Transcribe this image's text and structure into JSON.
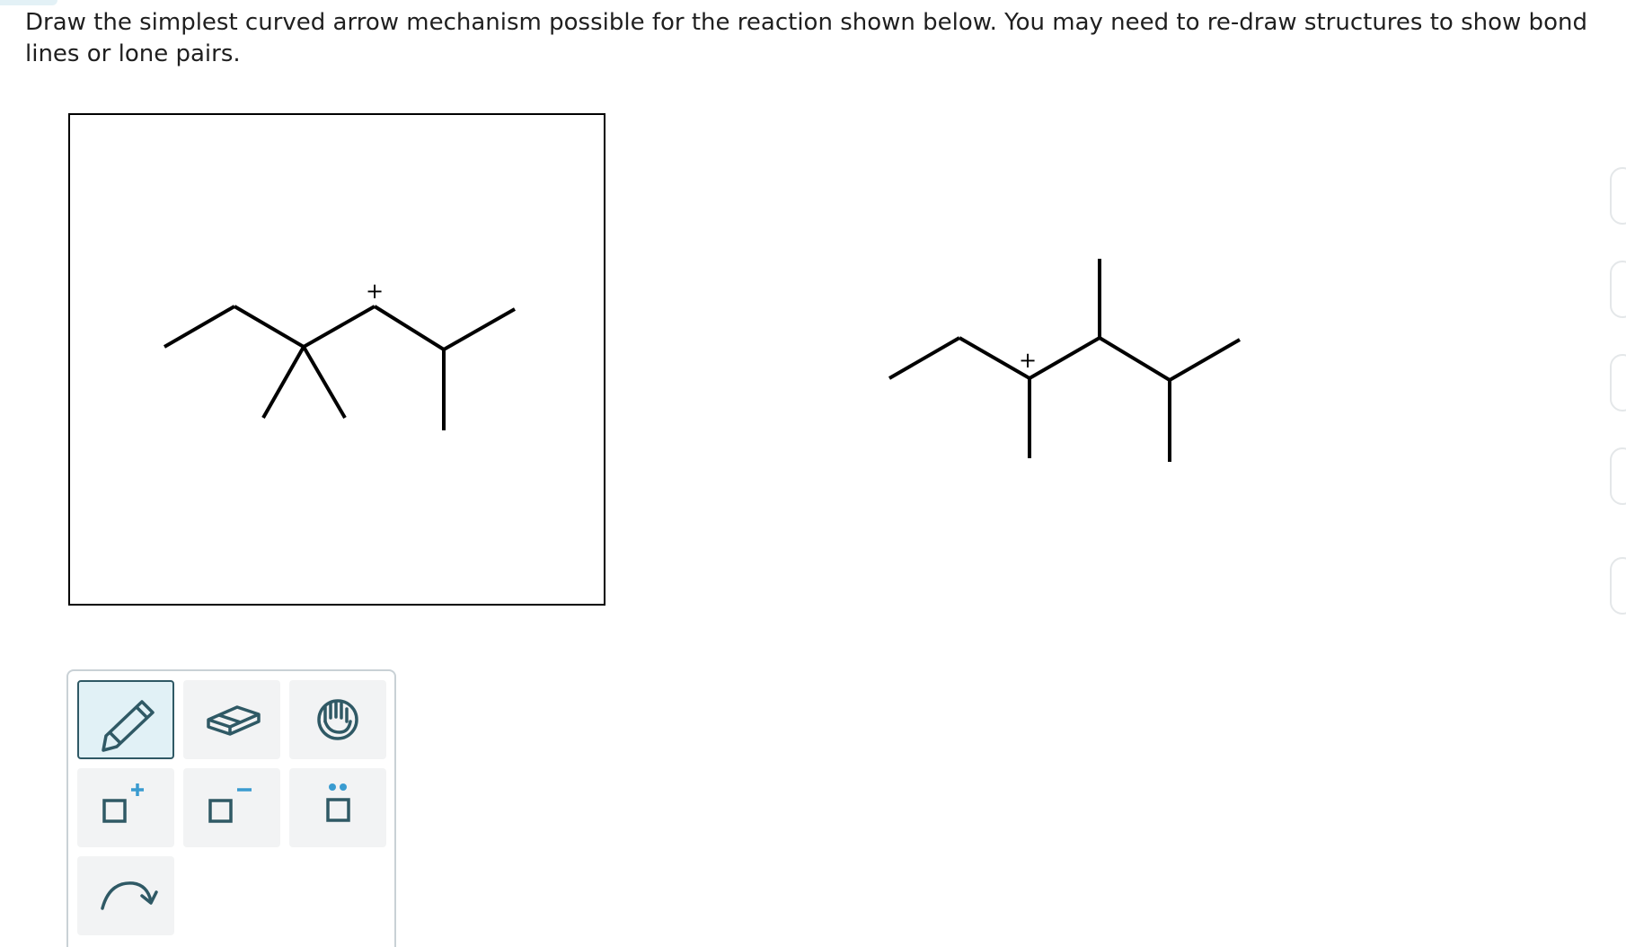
{
  "question": {
    "text": "Draw the simplest curved arrow mechanism possible for the reaction shown below. You may need to re-draw structures to show bond lines or lone pairs."
  },
  "reactant": {
    "charge_symbol": "+"
  },
  "product": {
    "charge_symbol": "+"
  },
  "toolbar": {
    "tools": [
      {
        "name": "pencil-icon",
        "selected": true
      },
      {
        "name": "eraser-icon",
        "selected": false
      },
      {
        "name": "hand-icon",
        "selected": false
      },
      {
        "name": "add-positive-charge-icon",
        "selected": false
      },
      {
        "name": "add-negative-charge-icon",
        "selected": false
      },
      {
        "name": "add-lone-pair-icon",
        "selected": false
      },
      {
        "name": "curved-arrow-icon",
        "selected": false
      }
    ]
  },
  "colors": {
    "selected_fill": "#e1f1f6",
    "selected_border": "#2f5965",
    "button_fill": "#f2f3f4",
    "icon_stroke": "#2f5965",
    "accent": "#3a9bd0"
  }
}
